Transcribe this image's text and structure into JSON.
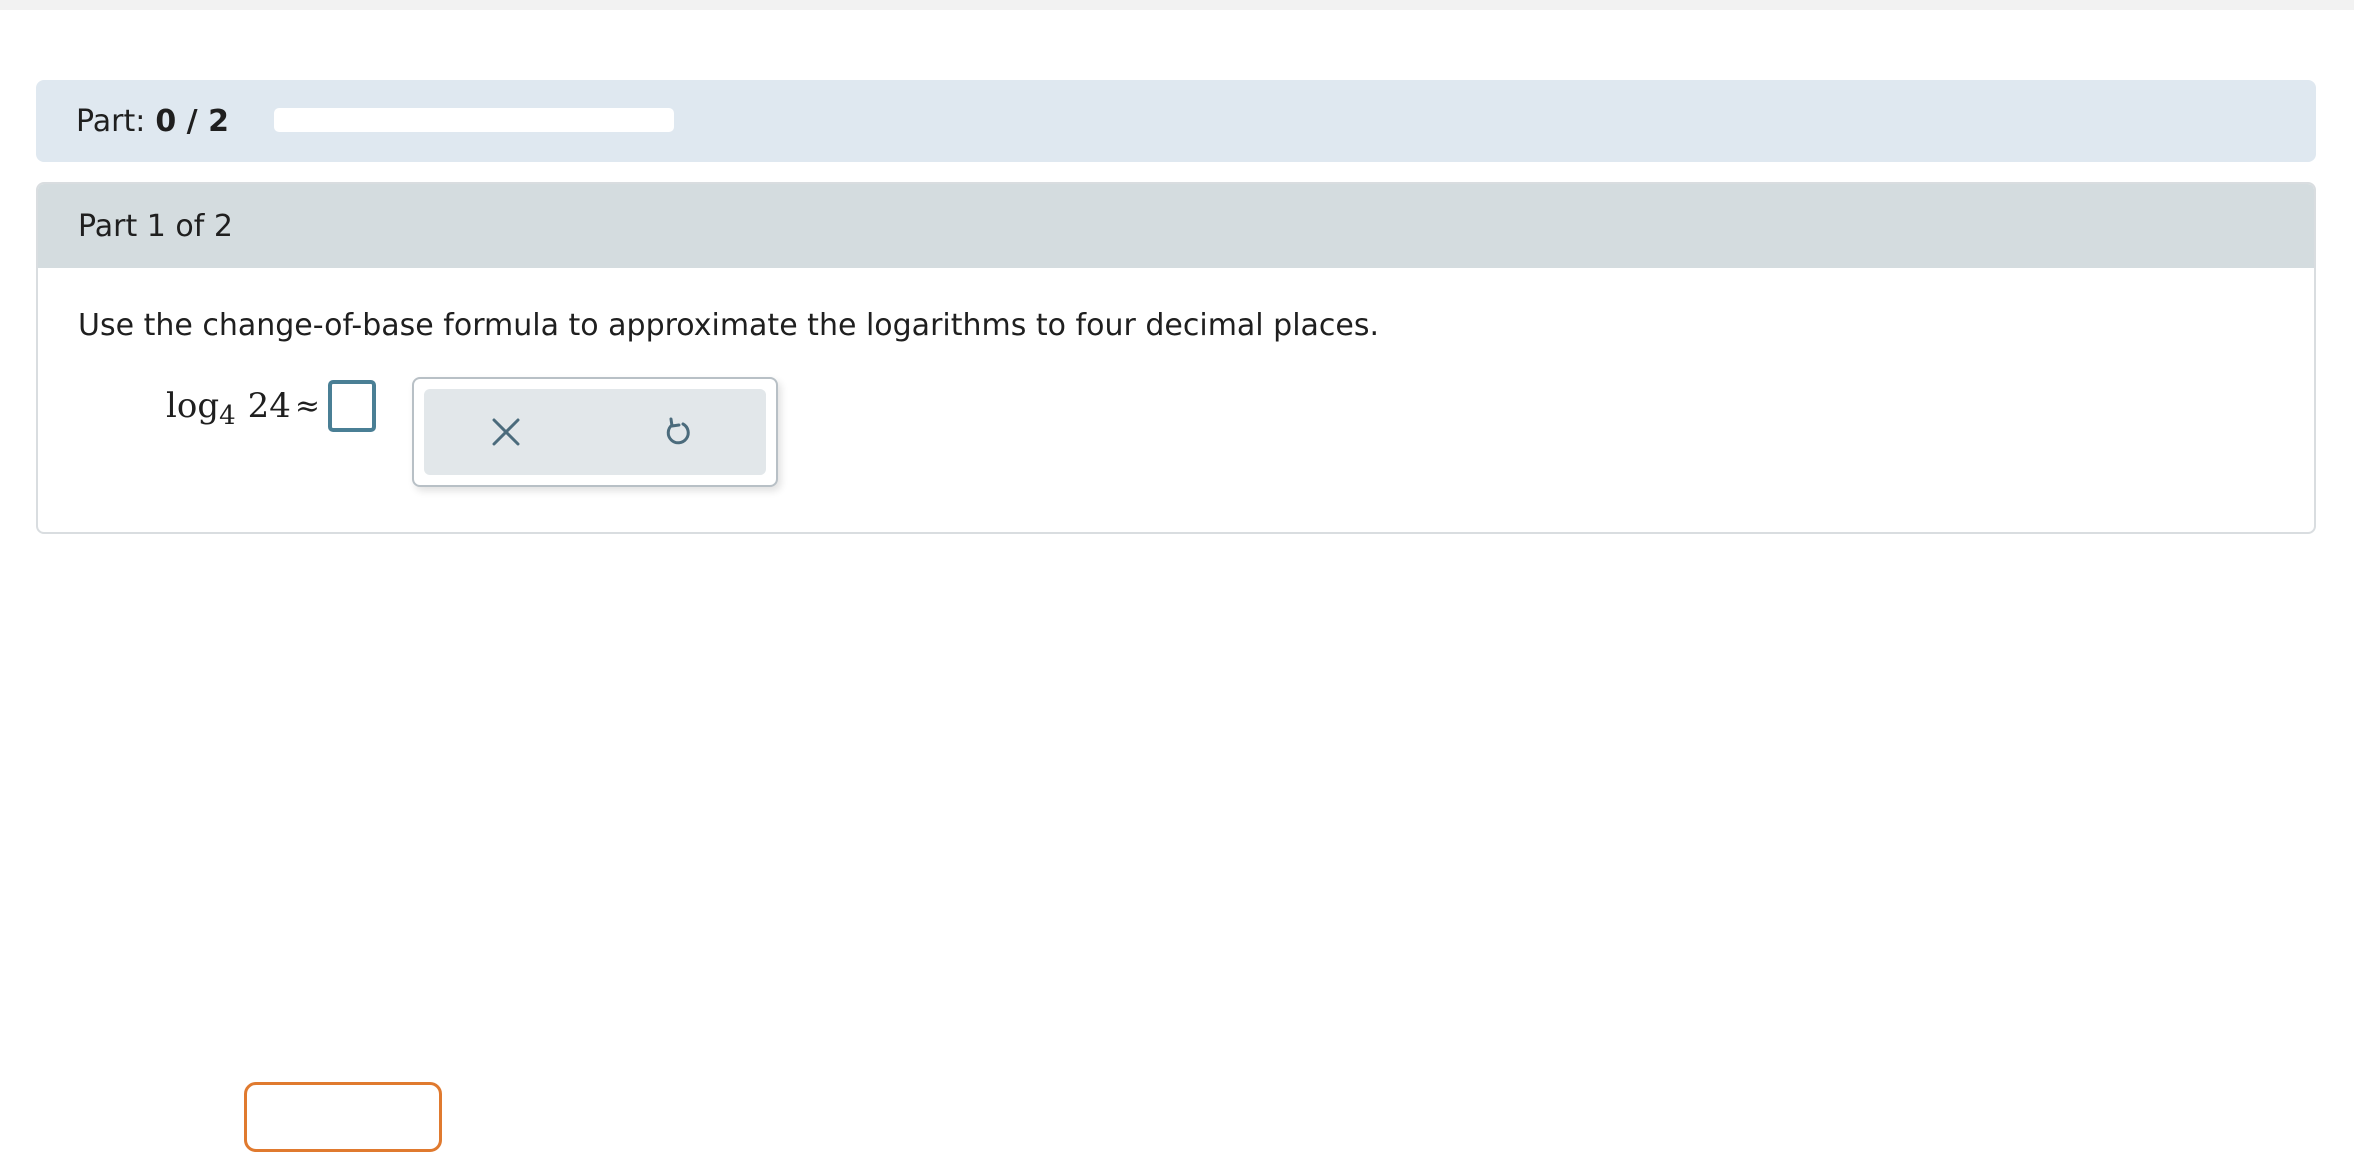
{
  "progress": {
    "label": "Part:",
    "count": "0 / 2",
    "fraction": 0
  },
  "part": {
    "header": "Part 1 of 2",
    "instruction": "Use the change-of-base formula to approximate the logarithms to four decimal places."
  },
  "math": {
    "func": "log",
    "base": "4",
    "argument": "24",
    "relation": "≈"
  },
  "tools": {
    "clear_icon": "x-icon",
    "undo_icon": "undo-icon"
  },
  "colors": {
    "progress_header_bg": "#dfe8f0",
    "part_header_bg": "#d4dcdf",
    "answer_box_border": "#4a7f95",
    "action_button_border": "#e07a2f"
  }
}
